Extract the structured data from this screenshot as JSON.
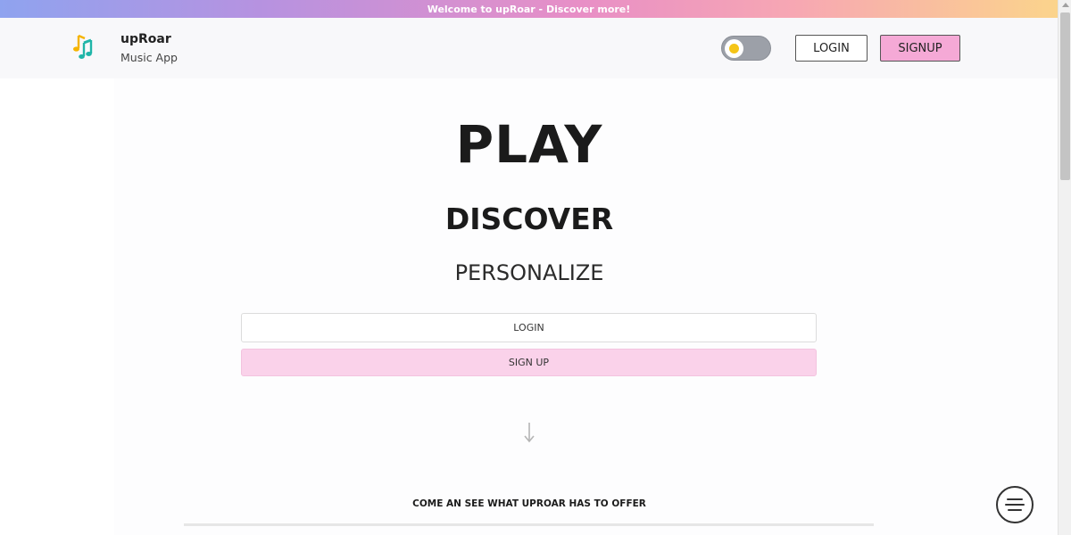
{
  "banner": {
    "text": "Welcome to upRoar - Discover more!"
  },
  "header": {
    "logo_icon": "music-notes-icon",
    "brand_name": "upRoar",
    "brand_subtitle": "Music App",
    "theme_toggle": {
      "icon": "sun-icon",
      "state": "light"
    },
    "login_label": "LOGIN",
    "signup_label": "SIGNUP"
  },
  "hero": {
    "line1": "PLAY",
    "line2": "DISCOVER",
    "line3": "PERSONALIZE",
    "login_label": "LOGIN",
    "signup_label": "SIGN UP",
    "arrow_icon": "arrow-down-icon",
    "offer_text": "COME AN SEE WHAT UPROAR HAS TO OFFER"
  },
  "fab": {
    "icon": "menu-icon"
  },
  "colors": {
    "accent_pink": "#f5a9d6",
    "signup_cta_bg": "#fad2ea",
    "toggle_bg": "#9ca0a8",
    "sun": "#f5c518"
  }
}
